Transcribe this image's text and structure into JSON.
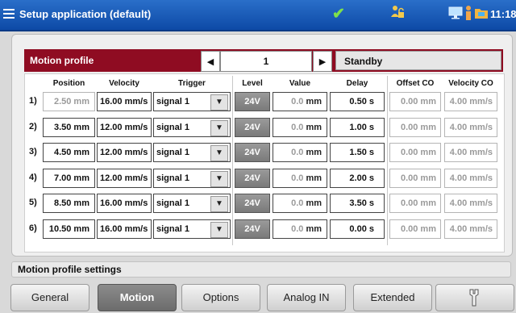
{
  "titlebar": {
    "title": "Setup application (default)",
    "time": "11:18",
    "accent": "#1a5cb8"
  },
  "motion_profile": {
    "title": "Motion profile",
    "page": "1",
    "status": "Standby",
    "header_color": "#8f0c22"
  },
  "columns": {
    "position": "Position",
    "velocity": "Velocity",
    "trigger": "Trigger",
    "level": "Level",
    "value": "Value",
    "delay": "Delay",
    "offset_co": "Offset CO",
    "velocity_co": "Velocity CO"
  },
  "rows": [
    {
      "num": "1)",
      "position": "2.50 mm",
      "velocity": "16.00 mm/s",
      "trigger": "signal 1",
      "level": "24V",
      "value": "0.0",
      "value_unit": "mm",
      "delay": "0.50  s",
      "offset_co": "0.00 mm",
      "velocity_co": "4.00 mm/s"
    },
    {
      "num": "2)",
      "position": "3.50 mm",
      "velocity": "12.00 mm/s",
      "trigger": "signal 1",
      "level": "24V",
      "value": "0.0",
      "value_unit": "mm",
      "delay": "1.00  s",
      "offset_co": "0.00 mm",
      "velocity_co": "4.00 mm/s"
    },
    {
      "num": "3)",
      "position": "4.50 mm",
      "velocity": "12.00 mm/s",
      "trigger": "signal 1",
      "level": "24V",
      "value": "0.0",
      "value_unit": "mm",
      "delay": "1.50  s",
      "offset_co": "0.00 mm",
      "velocity_co": "4.00 mm/s"
    },
    {
      "num": "4)",
      "position": "7.00 mm",
      "velocity": "12.00 mm/s",
      "trigger": "signal 1",
      "level": "24V",
      "value": "0.0",
      "value_unit": "mm",
      "delay": "2.00  s",
      "offset_co": "0.00 mm",
      "velocity_co": "4.00 mm/s"
    },
    {
      "num": "5)",
      "position": "8.50 mm",
      "velocity": "16.00 mm/s",
      "trigger": "signal 1",
      "level": "24V",
      "value": "0.0",
      "value_unit": "mm",
      "delay": "3.50  s",
      "offset_co": "0.00 mm",
      "velocity_co": "4.00 mm/s"
    },
    {
      "num": "6)",
      "position": "10.50 mm",
      "velocity": "16.00 mm/s",
      "trigger": "signal 1",
      "level": "24V",
      "value": "0.0",
      "value_unit": "mm",
      "delay": "0.00  s",
      "offset_co": "0.00 mm",
      "velocity_co": "4.00 mm/s"
    }
  ],
  "settings_label": "Motion profile settings",
  "tabs": {
    "general": "General",
    "motion": "Motion",
    "options": "Options",
    "analog_in": "Analog IN",
    "extended": "Extended"
  },
  "icons": {
    "menu": "menu-icon",
    "check": "checkmark-icon",
    "user_lock": "user-lock-icon",
    "monitor": "monitor-icon",
    "person": "person-icon",
    "folder": "folder-icon",
    "wrench": "wrench-icon"
  }
}
